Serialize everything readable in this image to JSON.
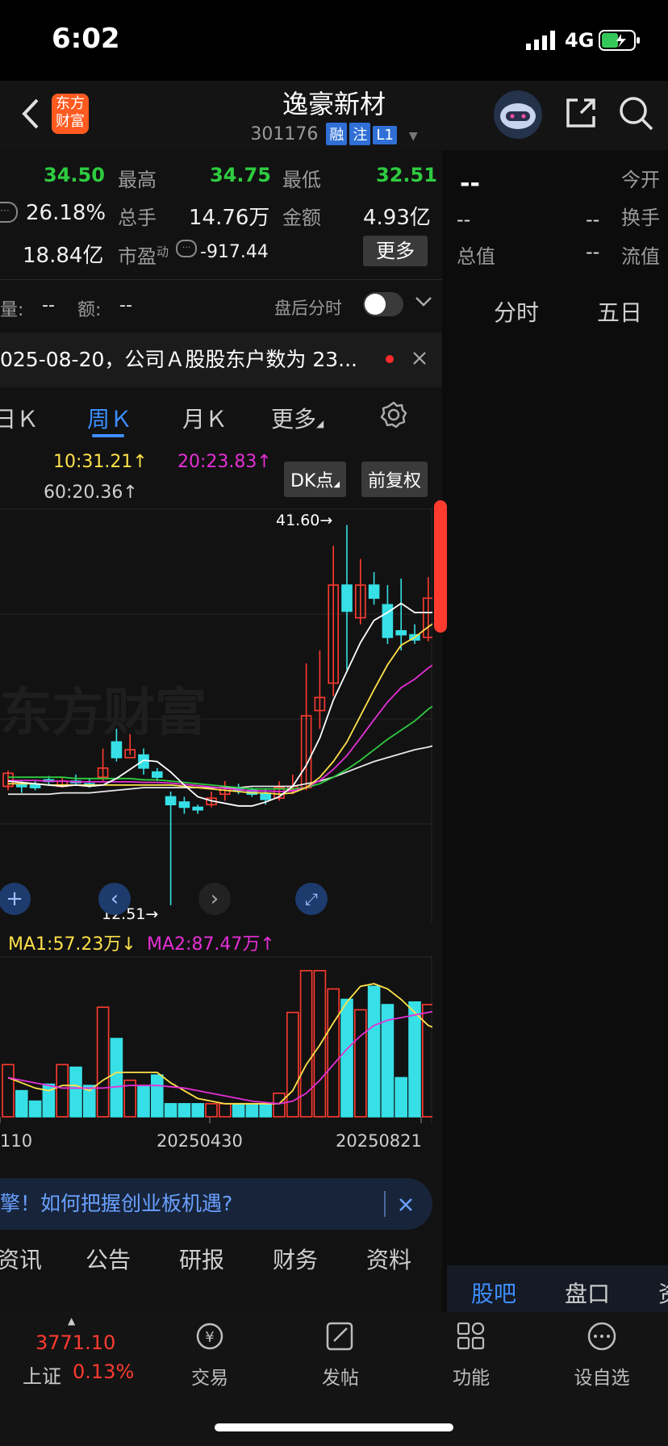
{
  "status_bar": {
    "time": "6:02",
    "network": "4G"
  },
  "header": {
    "logo_text": "东方财富",
    "stock_name": "逸豪新材",
    "stock_code": "301176",
    "tags": [
      "融",
      "注",
      "L1"
    ]
  },
  "quote": {
    "row1": {
      "value1": "34.50",
      "high_label": "最高",
      "high": "34.75",
      "low_label": "最低",
      "low": "32.51"
    },
    "row2": {
      "turnover_pct": "26.18%",
      "volume_label": "总手",
      "volume": "14.76万",
      "amount_label": "金额",
      "amount": "4.93亿"
    },
    "row3": {
      "mktcap": "18.84亿",
      "pe_label": "市盈",
      "pe_sup": "动",
      "pe": "-917.44",
      "more": "更多"
    },
    "right": {
      "dash": "--",
      "open_label": "今开",
      "turnover_label": "换手",
      "total_label": "总值",
      "float_label": "流值"
    }
  },
  "after_hours": {
    "vol_label": "量:",
    "vol": "--",
    "amt_label": "额:",
    "amt": "--",
    "toggle_label": "盘后分时"
  },
  "announcement": {
    "text": "025-08-20，公司Ａ股股东户数为 23..."
  },
  "kline_tabs": {
    "day": "日Ｋ",
    "week": "周Ｋ",
    "month": "月Ｋ",
    "more": "更多"
  },
  "right_tabs": {
    "minute": "分时",
    "five_day": "五日"
  },
  "chart_legend": {
    "ma10": "10:31.21↑",
    "ma20": "20:23.83↑",
    "ma60": "60:20.36↑",
    "dk_button": "DK点",
    "fq_button": "前复权"
  },
  "chart_marks": {
    "high_label": "41.60→",
    "low_label": "12.51→",
    "watermark": "东方财富"
  },
  "vol_legend": {
    "ma1": "MA1:57.23万↓",
    "ma2": "MA2:87.47万↑"
  },
  "x_axis": {
    "left": "110",
    "mid": "20250430",
    "right": "20250821"
  },
  "banner": {
    "text": "擎！如何把握创业板机遇?"
  },
  "bottom_tabs": [
    "资讯",
    "公告",
    "研报",
    "财务",
    "资料"
  ],
  "right_bottom_tabs": {
    "guba": "股吧",
    "pankou": "盘口",
    "zi": "资"
  },
  "footer": {
    "index_value": "3771.10",
    "index_name": "上证",
    "index_change": "0.13%",
    "items": [
      "交易",
      "发帖",
      "功能",
      "设自选"
    ]
  },
  "colors": {
    "up": "#ff3b30",
    "down": "#36e0e6",
    "ma5": "#ffffff",
    "ma10": "#ffe14a",
    "ma20": "#e52fd6",
    "ma60": "#2ecc40",
    "accent": "#3d8eff"
  },
  "chart_data": {
    "type": "candlestick",
    "price_range": [
      12.0,
      42.5
    ],
    "candles": [
      [
        21.6,
        22.6,
        21.3,
        22.8
      ],
      [
        21.7,
        21.6,
        21.1,
        22.0
      ],
      [
        21.7,
        21.5,
        21.3,
        22.0
      ],
      [
        22.1,
        22.0,
        21.7,
        22.4
      ],
      [
        21.6,
        22.0,
        21.5,
        22.3
      ],
      [
        22.0,
        21.9,
        21.7,
        22.5
      ],
      [
        21.8,
        21.7,
        21.5,
        22.2
      ],
      [
        22.3,
        23.0,
        22.0,
        24.5
      ],
      [
        25.0,
        23.8,
        23.5,
        26.0
      ],
      [
        23.8,
        24.4,
        24.0,
        25.6
      ],
      [
        24.0,
        23.0,
        22.5,
        24.5
      ],
      [
        22.7,
        22.3,
        22.0,
        23.0
      ],
      [
        20.8,
        20.2,
        12.5,
        21.2
      ],
      [
        20.4,
        20.0,
        19.5,
        20.8
      ],
      [
        20.0,
        19.8,
        19.5,
        20.2
      ],
      [
        20.2,
        20.7,
        20.0,
        21.2
      ],
      [
        21.0,
        21.5,
        20.5,
        22.0
      ],
      [
        21.5,
        21.3,
        21.0,
        21.8
      ],
      [
        21.3,
        21.0,
        20.8,
        21.5
      ],
      [
        21.0,
        20.6,
        20.2,
        21.4
      ],
      [
        20.7,
        21.5,
        20.5,
        22.0
      ],
      [
        21.3,
        21.6,
        21.0,
        22.5
      ],
      [
        21.5,
        27.0,
        21.3,
        31.0
      ],
      [
        27.4,
        28.4,
        26.0,
        32.0
      ],
      [
        29.5,
        37.0,
        28.5,
        40.0
      ],
      [
        37.0,
        35.0,
        30.5,
        41.6
      ],
      [
        34.5,
        37.0,
        34.0,
        39.0
      ],
      [
        37.0,
        36.0,
        35.5,
        38.0
      ],
      [
        35.5,
        33.0,
        32.5,
        37.0
      ],
      [
        33.5,
        33.2,
        32.0,
        37.5
      ],
      [
        33.2,
        32.8,
        32.5,
        34.0
      ],
      [
        33.0,
        36.0,
        32.7,
        37.6
      ],
      [
        36.0,
        34.5,
        33.7,
        38.0
      ]
    ],
    "ma5": [
      22.0,
      21.9,
      21.8,
      21.7,
      21.6,
      21.7,
      21.6,
      21.7,
      22.2,
      22.9,
      23.6,
      23.5,
      22.7,
      21.7,
      20.8,
      20.5,
      20.3,
      20.1,
      20.1,
      20.4,
      20.8,
      21.6,
      23.2,
      25.3,
      28.2,
      30.4,
      32.6,
      34.3,
      34.9,
      35.6,
      34.9,
      34.9,
      34.9
    ],
    "ma10": [
      21.8,
      21.8,
      21.8,
      21.7,
      21.7,
      21.7,
      21.7,
      21.7,
      21.7,
      21.7,
      21.7,
      21.7,
      21.7,
      21.6,
      21.5,
      21.4,
      21.3,
      21.2,
      21.1,
      21.1,
      21.0,
      21.1,
      21.5,
      22.3,
      23.5,
      25.0,
      27.0,
      29.0,
      30.9,
      32.4,
      33.0,
      33.8,
      34.5
    ],
    "ma20": [
      22.3,
      22.3,
      22.3,
      22.3,
      22.3,
      22.2,
      22.2,
      22.2,
      22.2,
      22.2,
      22.1,
      22.1,
      22.0,
      21.9,
      21.8,
      21.7,
      21.6,
      21.5,
      21.4,
      21.4,
      21.4,
      21.4,
      21.5,
      21.8,
      22.3,
      22.9,
      23.6,
      24.4,
      25.2,
      25.9,
      26.6,
      27.5,
      28.2
    ],
    "ma60": [
      21.0,
      21.0,
      21.0,
      21.0,
      21.1,
      21.1,
      21.1,
      21.2,
      21.3,
      21.4,
      21.5,
      21.5,
      21.5,
      21.5,
      21.5,
      21.5,
      21.5,
      21.5,
      21.6,
      21.6,
      21.6,
      21.6,
      21.8,
      22.0,
      22.3,
      22.7,
      23.1,
      23.5,
      23.8,
      24.1,
      24.4,
      24.6,
      24.9
    ],
    "volume_unit": "万",
    "volumes": [
      40,
      20,
      12,
      25,
      40,
      38,
      24,
      84,
      60,
      28,
      24,
      32,
      10,
      10,
      10,
      10,
      10,
      10,
      10,
      10,
      18,
      80,
      112,
      112,
      98,
      90,
      82,
      100,
      86,
      30,
      88,
      86,
      96
    ],
    "vol_ma1": [
      30,
      26,
      22,
      20,
      24,
      24,
      20,
      28,
      34,
      34,
      34,
      34,
      26,
      20,
      14,
      12,
      10,
      10,
      10,
      10,
      10,
      20,
      40,
      55,
      72,
      88,
      100,
      102,
      98,
      90,
      80,
      70,
      66
    ],
    "vol_ma2": [
      30,
      28,
      26,
      24,
      22,
      22,
      22,
      22,
      23,
      24,
      24,
      24,
      23,
      22,
      20,
      18,
      16,
      14,
      12,
      11,
      10,
      12,
      18,
      28,
      40,
      52,
      62,
      70,
      74,
      76,
      78,
      80,
      82
    ],
    "x_labels": [
      "110",
      "20250430",
      "20250821"
    ]
  }
}
